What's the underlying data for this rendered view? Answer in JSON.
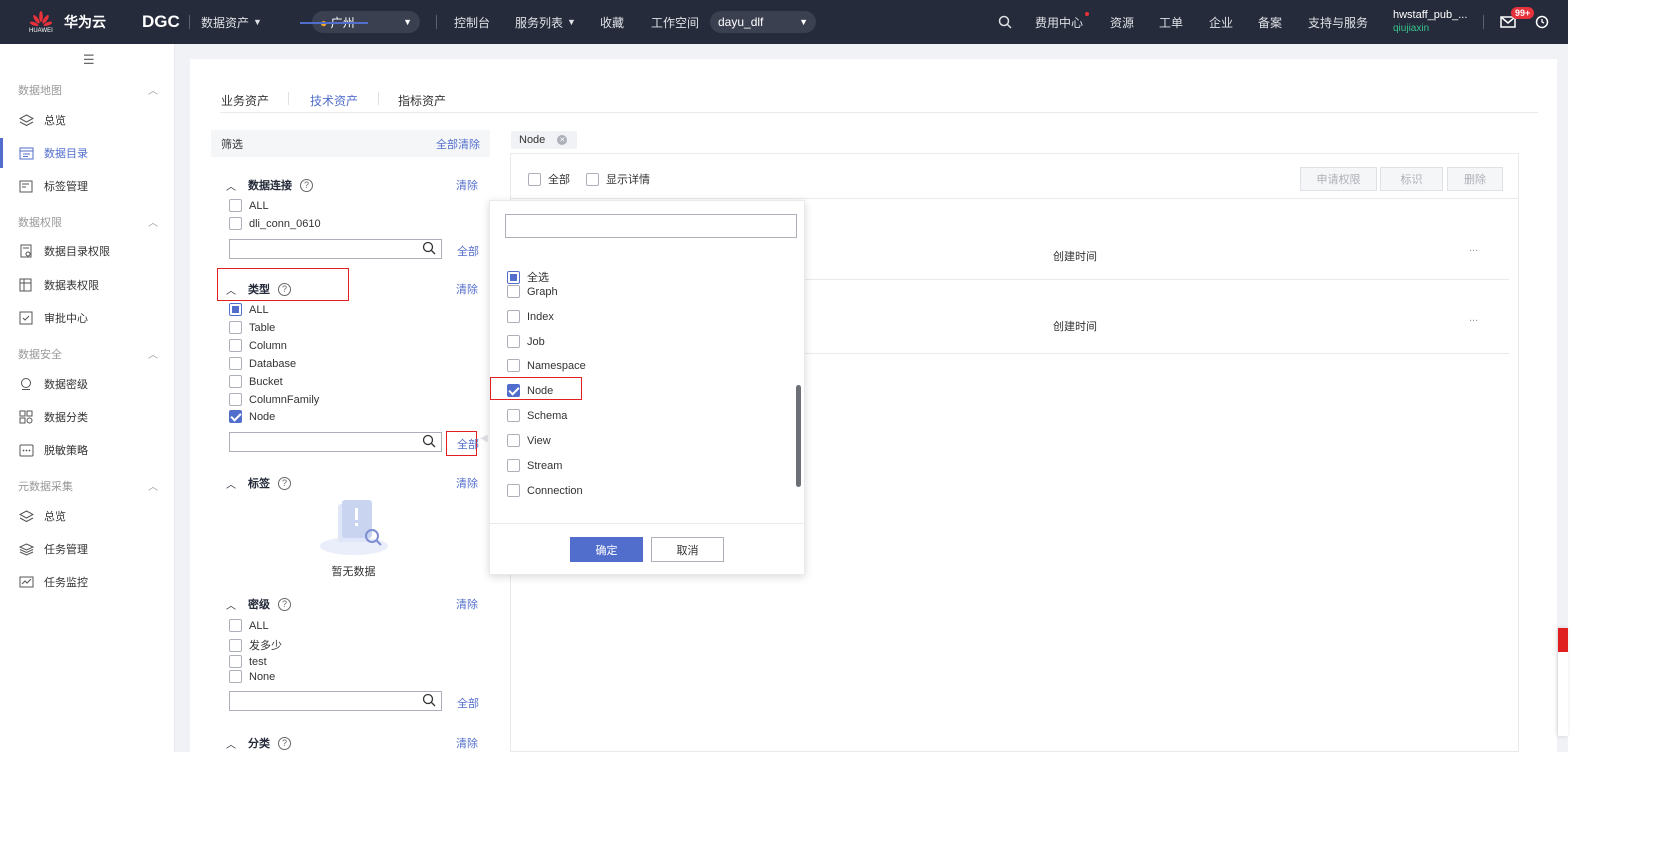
{
  "topbar": {
    "brand": "华为云",
    "brand_small": "HUAWEI",
    "product": "DGC",
    "data_assets_menu": "数据资产",
    "region": "广州",
    "console": "控制台",
    "service_list": "服务列表",
    "favorites": "收藏",
    "workspace_label": "工作空间",
    "workspace": "dayu_dlf",
    "billing": "费用中心",
    "resources": "资源",
    "tickets": "工单",
    "enterprise": "企业",
    "icp": "备案",
    "support": "支持与服务",
    "username": "hwstaff_pub_...",
    "subuser": "qiujiaxin",
    "mail_badge": "99+"
  },
  "sidebar": {
    "groups": [
      {
        "title": "数据地图",
        "items": [
          {
            "label": "总览"
          },
          {
            "label": "数据目录"
          },
          {
            "label": "标签管理"
          }
        ]
      },
      {
        "title": "数据权限",
        "items": [
          {
            "label": "数据目录权限"
          },
          {
            "label": "数据表权限"
          },
          {
            "label": "审批中心"
          }
        ]
      },
      {
        "title": "数据安全",
        "items": [
          {
            "label": "数据密级"
          },
          {
            "label": "数据分类"
          },
          {
            "label": "脱敏策略"
          }
        ]
      },
      {
        "title": "元数据采集",
        "items": [
          {
            "label": "总览"
          },
          {
            "label": "任务管理"
          },
          {
            "label": "任务监控"
          }
        ]
      }
    ]
  },
  "tabs": [
    "业务资产",
    "技术资产",
    "指标资产"
  ],
  "filter": {
    "title": "筛选",
    "clear_all": "全部清除",
    "clear": "清除",
    "all_link": "全部",
    "connection": {
      "title": "数据连接",
      "options": [
        "ALL",
        "dli_conn_0610"
      ]
    },
    "type": {
      "title": "类型",
      "options": [
        "ALL",
        "Table",
        "Column",
        "Database",
        "Bucket",
        "ColumnFamily",
        "Node"
      ]
    },
    "tag": {
      "title": "标签",
      "empty": "暂无数据"
    },
    "level": {
      "title": "密级",
      "options": [
        "ALL",
        "发多少",
        "test",
        "None"
      ]
    },
    "category": {
      "title": "分类"
    }
  },
  "selected_tag": "Node",
  "list": {
    "select_all": "全部",
    "show_details": "显示详情",
    "request_permission": "申请权限",
    "mark": "标识",
    "delete": "删除",
    "rows": [
      {
        "created_label": "创建时间",
        "more": "..."
      },
      {
        "created_label": "创建时间",
        "more": "..."
      }
    ]
  },
  "dropdown": {
    "options": [
      "全选",
      "Graph",
      "Index",
      "Job",
      "Namespace",
      "Node",
      "Schema",
      "View",
      "Stream",
      "Connection"
    ],
    "ok": "确定",
    "cancel": "取消"
  },
  "colors": {
    "accent": "#526ecc",
    "topbar": "#252b3a",
    "highlight": "#e02020"
  }
}
